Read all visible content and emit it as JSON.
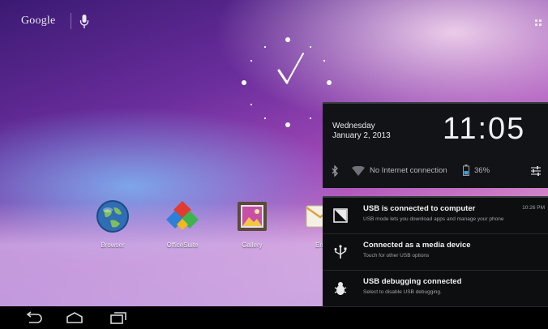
{
  "topbar": {
    "google_label": "Google"
  },
  "apps": [
    {
      "label": "Browser",
      "icon": "browser-globe-icon"
    },
    {
      "label": "OfficeSuite",
      "icon": "officesuite-icon"
    },
    {
      "label": "Gallery",
      "icon": "gallery-icon"
    },
    {
      "label": "Em",
      "icon": "email-icon"
    }
  ],
  "clock_panel": {
    "day": "Wednesday",
    "date": "January 2, 2013",
    "time": "11:05",
    "network_status": "No Internet connection",
    "battery": "36%"
  },
  "notifications": [
    {
      "title": "USB is connected to computer",
      "subtitle": "USB mode lets you download apps and manage your phone",
      "time": "10:26 PM",
      "icon": "usb-mode-icon"
    },
    {
      "title": "Connected as a media device",
      "subtitle": "Touch for other USB options",
      "time": "",
      "icon": "usb-icon"
    },
    {
      "title": "USB debugging connected",
      "subtitle": "Select to disable USB debugging.",
      "time": "",
      "icon": "debug-bug-icon"
    }
  ]
}
